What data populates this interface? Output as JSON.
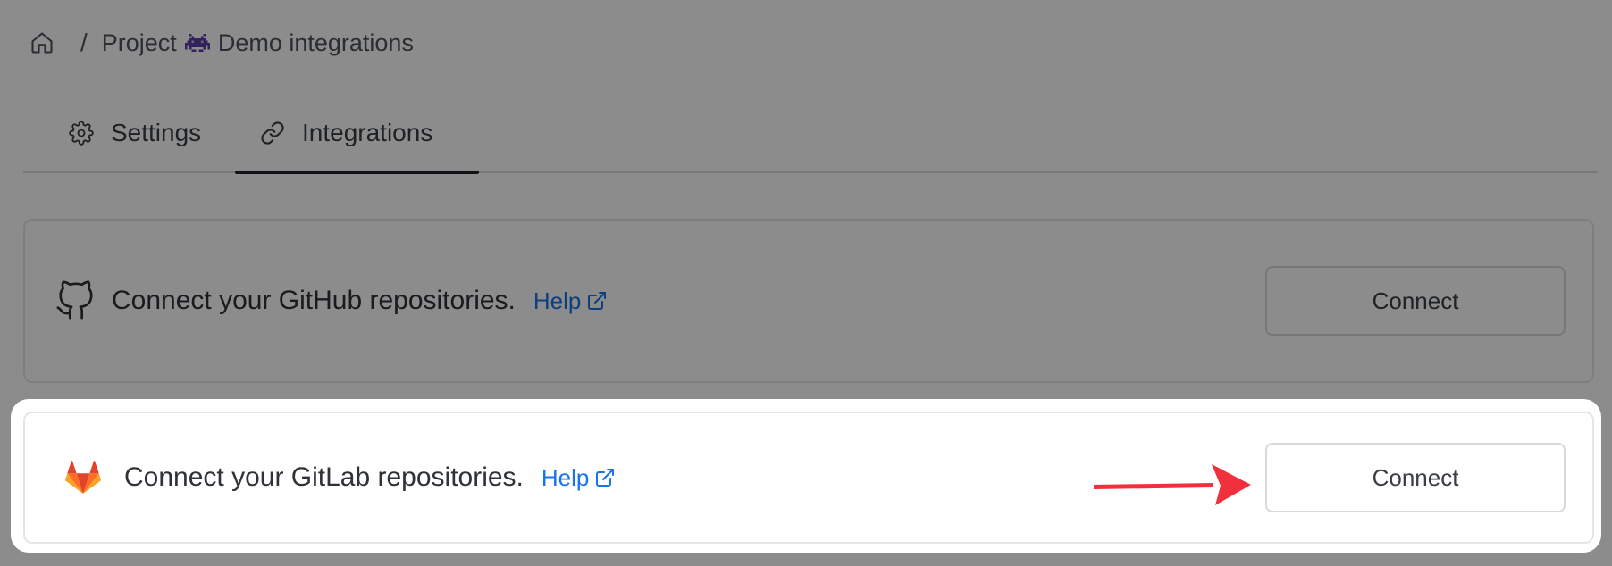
{
  "breadcrumb": {
    "home_icon": "home-icon",
    "separator": "/",
    "project_prefix": "Project",
    "project_logo_icon": "space-invader-icon",
    "project_name": "Demo integrations"
  },
  "tabs": [
    {
      "label": "Settings",
      "icon": "gear-icon",
      "active": false
    },
    {
      "label": "Integrations",
      "icon": "link-icon",
      "active": true
    }
  ],
  "integrations": [
    {
      "provider": "GitHub",
      "icon": "github-icon",
      "text": "Connect your GitHub repositories.",
      "help_label": "Help",
      "button_label": "Connect",
      "highlighted": false
    },
    {
      "provider": "GitLab",
      "icon": "gitlab-icon",
      "text": "Connect your GitLab repositories.",
      "help_label": "Help",
      "button_label": "Connect",
      "highlighted": true
    }
  ],
  "colors": {
    "link": "#1a73e8",
    "annotation_arrow": "#f0303a",
    "overlay": "rgba(0,0,0,0.45)"
  }
}
